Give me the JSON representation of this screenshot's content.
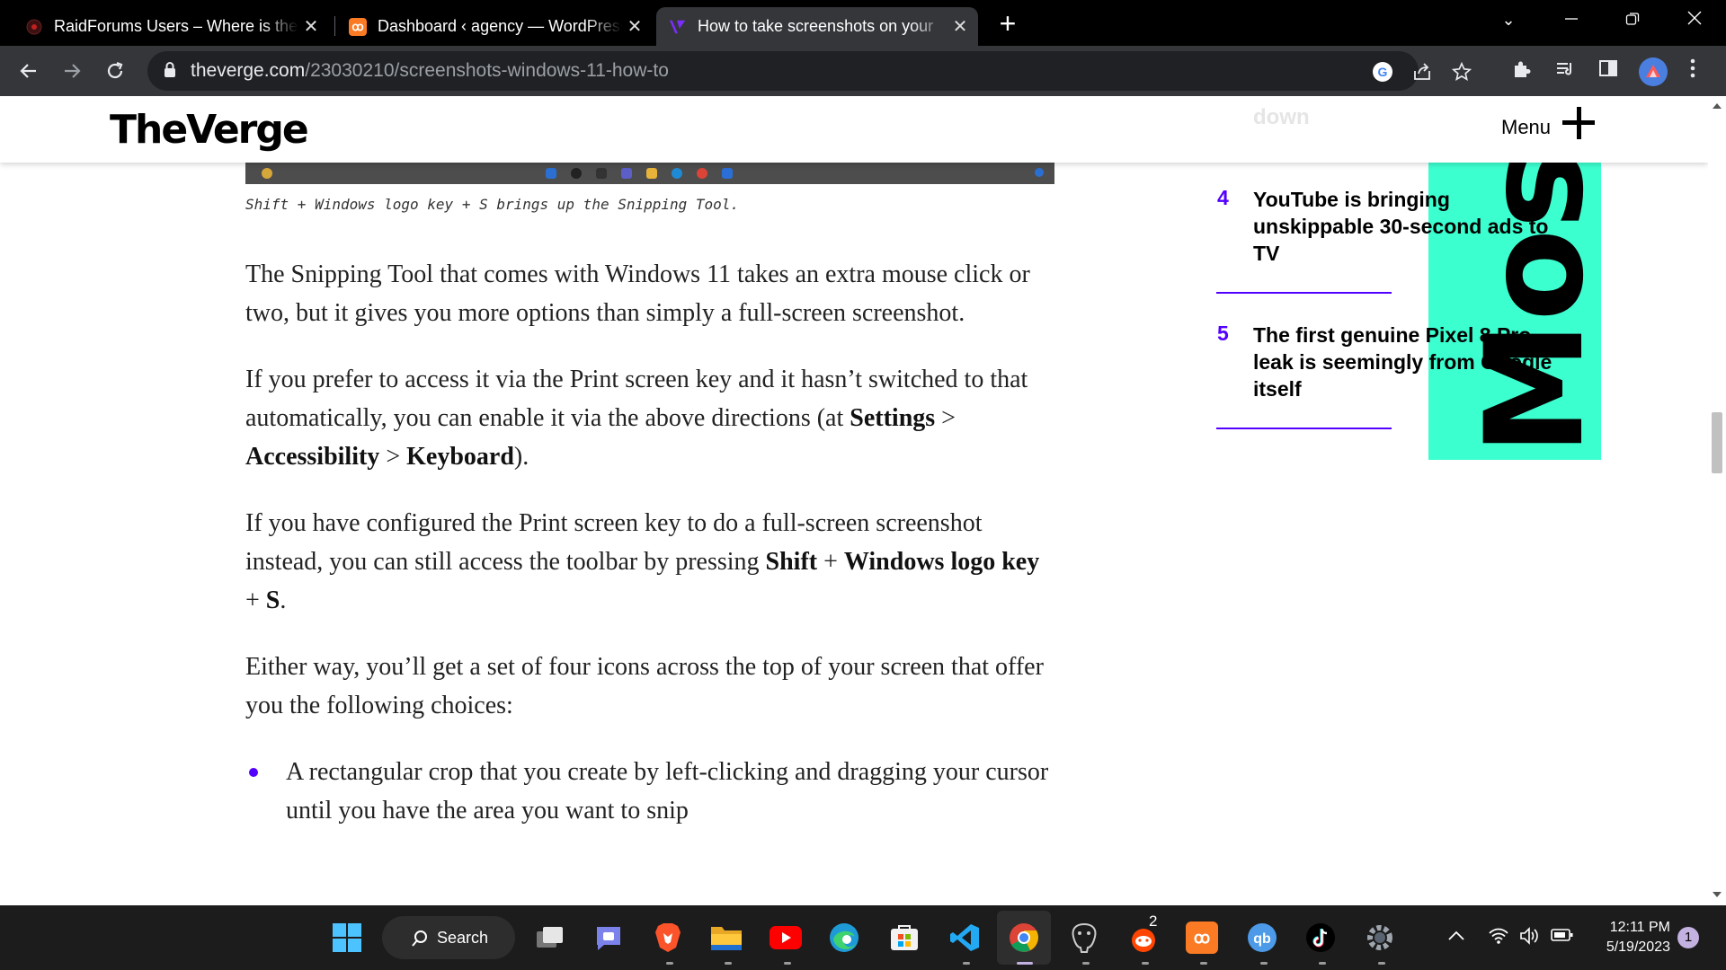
{
  "browser": {
    "tabs": [
      {
        "title": "RaidForums Users – Where is the",
        "favicon": "raidforums-icon",
        "active": false
      },
      {
        "title": "Dashboard ‹ agency — WordPress",
        "favicon": "xampp-icon",
        "active": false
      },
      {
        "title": "How to take screenshots on your",
        "favicon": "verge-icon",
        "active": true
      }
    ],
    "new_tab": "+",
    "url_host": "theverge.com",
    "url_path": "/23030210/screenshots-windows-11-how-to"
  },
  "site": {
    "logo": "TheVerge",
    "menu_label": "Menu",
    "faded_top": "down"
  },
  "article": {
    "caption": "Shift + Windows logo key + S brings up the Snipping Tool.",
    "p1": "The Snipping Tool that comes with Windows 11 takes an extra mouse click or two, but it gives you more options than simply a full-screen screenshot.",
    "p2_a": "If you prefer to access it via the Print screen key and it hasn’t switched to that automatically, you can enable it via the above directions (at ",
    "p2_b1": "Settings",
    "p2_sep1": " > ",
    "p2_b2": "Accessibility",
    "p2_sep2": " > ",
    "p2_b3": "Keyboard",
    "p2_end": ").",
    "p3_a": "If you have configured the Print screen key to do a full-screen screenshot instead, you can still access the toolbar by pressing ",
    "p3_b1": "Shift",
    "p3_sep1": " + ",
    "p3_b2": "Windows logo key",
    "p3_sep2": " + ",
    "p3_b3": "S",
    "p3_end": ".",
    "p4": "Either way, you’ll get a set of four icons across the top of your screen that offer you the following choices:",
    "bullet1": "A rectangular crop that you create by left-clicking and dragging your cursor until you have the area you want to snip"
  },
  "most_popular": {
    "vertical_label": "Most Popular",
    "items": [
      {
        "rank": "4",
        "title": "YouTube is bringing unskippable 30-second ads to TV"
      },
      {
        "rank": "5",
        "title": "The first genuine Pixel 8 Pro leak is seemingly from Google itself"
      }
    ]
  },
  "taskbar": {
    "search_label": "Search",
    "reddit_badge": "2",
    "time": "12:11 PM",
    "date": "5/19/2023",
    "notifications": "1"
  },
  "colors": {
    "accent_purple": "#5200ff",
    "most_popular_mint": "#3cffd0",
    "chrome_dark": "#35363a"
  }
}
